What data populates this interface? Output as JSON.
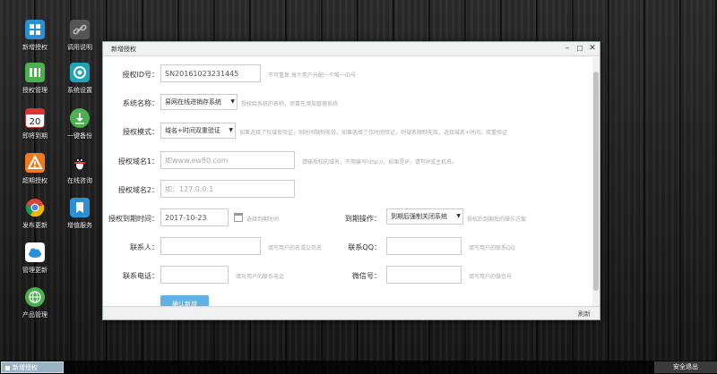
{
  "desktop": {
    "icons": [
      {
        "label": "新增授权"
      },
      {
        "label": "调用说明"
      },
      {
        "label": "授权管理"
      },
      {
        "label": "系统设置"
      },
      {
        "label": "即将到期"
      },
      {
        "label": "一键备份"
      },
      {
        "label": "超期授权"
      },
      {
        "label": "在线咨询"
      },
      {
        "label": "发布更新"
      },
      {
        "label": "增值服务"
      },
      {
        "label": "管理更新"
      },
      {
        "label": "产品管理"
      }
    ],
    "icon_colors": {
      "blue": "#2b8fd6",
      "green": "#4caf50",
      "orange": "#f07a1c",
      "teal": "#21a3b5"
    }
  },
  "window": {
    "title": "新增授权",
    "controls": {
      "minimize": "–",
      "maximize": "☐",
      "close": "✕"
    },
    "status_refresh": "刷新"
  },
  "form": {
    "auth_id": {
      "label": "授权ID号：",
      "value": "SN20161023231445",
      "hint": "不可重复,每个用户分配一个唯一ID号"
    },
    "system": {
      "label": "系统名称：",
      "value": "易网在线进销存系统",
      "hint": "授权给系统的名称，须事先添加管理系统"
    },
    "mode": {
      "label": "授权模式：",
      "value": "域名+时间双重验证",
      "hint": "如果选择了仅域名验证，则时间限制无效，如果选择了仅时间验证，则域名限制无效，选择域名+时间，双重验证"
    },
    "domain1": {
      "label": "授权域名1：",
      "placeholder": "如www.ew80.com",
      "hint": "请输授权的域名，不用输写http://，如果是IP，请写IP或主机名。"
    },
    "domain2": {
      "label": "授权域名2：",
      "placeholder": "如：127.0.0.1"
    },
    "expire_time": {
      "label": "授权到期时间：",
      "value": "2017-10-23",
      "hint": "选择到期时间"
    },
    "expire_action": {
      "label": "到期操作：",
      "value": "到期后强制关闭系统",
      "hint": "授权后到期后的操作方案"
    },
    "contact": {
      "label": "联系人：",
      "hint": "填写用户的名或公司名"
    },
    "qq": {
      "label": "联系QQ：",
      "hint": "填写用户的联系QQ"
    },
    "phone": {
      "label": "联系电话：",
      "hint": "填写用户的联系电话"
    },
    "wechat": {
      "label": "微信号：",
      "hint": "填写用户的微信号"
    },
    "submit_label": "确认新增"
  },
  "taskbar": {
    "active_task": "新增授权",
    "logout": "安全退出"
  }
}
